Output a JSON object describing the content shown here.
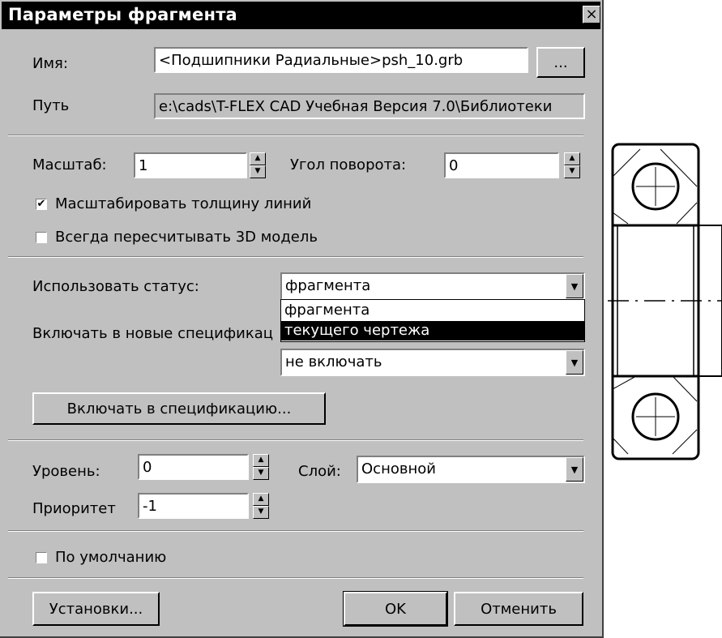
{
  "dialog": {
    "title": "Параметры фрагмента",
    "close_label": "×"
  },
  "file": {
    "name_label": "Имя:",
    "name_value": "<Подшипники Радиальные>psh_10.grb",
    "browse_label": "...",
    "path_label": "Путь",
    "path_value": "e:\\cads\\T-FLEX CAD Учебная Версия 7.0\\Библиотеки"
  },
  "transform": {
    "scale_label": "Масштаб:",
    "scale_value": "1",
    "angle_label": "Угол поворота:",
    "angle_value": "0",
    "scale_lines_label": "Масштабировать толщину линий",
    "scale_lines_checked": true,
    "recalc_3d_label": "Всегда пересчитывать 3D модель",
    "recalc_3d_checked": false
  },
  "status": {
    "use_status_label": "Использовать статус:",
    "use_status_value": "фрагмента",
    "include_new_spec_label": "Включать в новые спецификац",
    "options": [
      "фрагмента",
      "текущего чертежа"
    ],
    "highlighted_option": "текущего чертежа",
    "spec_combo_value": "не включать",
    "include_spec_button": "Включать в спецификацию..."
  },
  "layer": {
    "level_label": "Уровень:",
    "level_value": "0",
    "layer_label": "Слой:",
    "layer_value": "Основной",
    "priority_label": "Приоритет",
    "priority_value": "-1"
  },
  "defaults": {
    "default_label": "По умолчанию",
    "default_checked": false
  },
  "footer": {
    "settings_button": "Установки...",
    "ok_button": "OK",
    "cancel_button": "Отменить"
  },
  "icons": {
    "checkmark": "✔",
    "arrow_up": "▲",
    "arrow_down": "▼"
  }
}
